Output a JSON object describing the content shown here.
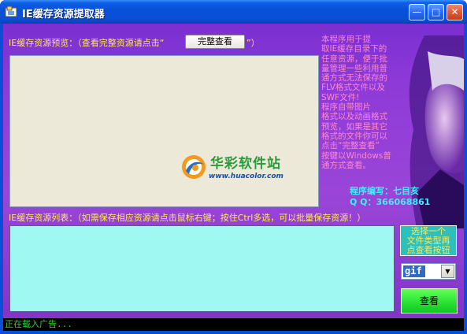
{
  "window": {
    "title": "IE缓存资源提取器",
    "minimize_glyph": "—",
    "maximize_glyph": "□",
    "close_glyph": "✕"
  },
  "preview": {
    "label_prefix": "IE缓存资源预览：（查看完整资源请点击“",
    "label_suffix": "”）",
    "full_view_button": "完整查看",
    "logo_name": "华彩软件站",
    "logo_url": "www.huacolor.com"
  },
  "description": {
    "lines": [
      "    本程序用于提",
      "取IE缓存目录下的",
      "任意资源，便于批",
      "量管理一些利用普",
      "通方式无法保存的",
      "FLV格式文件以及",
      "SWF文件!",
      "    程序自带图片",
      "格式以及动画格式",
      "预览，如果是其它",
      "格式的文件你可以",
      "点击“完整查看”",
      "按键以Windows普",
      "通方式查看。"
    ]
  },
  "author": {
    "line1": "程序编写：七目亥",
    "line2": "Q  Q：366068861"
  },
  "list": {
    "label": "IE缓存资源列表：（如需保存相应资源请点击鼠标右键；按住Ctrl多选，可以批量保存资源！）"
  },
  "controls": {
    "hint_lines": [
      "选择一个",
      "文件类型再",
      "点查看按钮"
    ],
    "file_type_selected": "gif",
    "view_button": "查看"
  },
  "status": {
    "text": "正在载入广告..."
  },
  "colors": {
    "client_bg": "#8e3ad8",
    "label_yellow": "#ffe85a",
    "desc_pink": "#ff88cc",
    "author_cyan": "#40f0ff",
    "list_bg": "#9ff8f2",
    "view_button_green": "#2ee63a",
    "status_green": "#2bd62b"
  }
}
